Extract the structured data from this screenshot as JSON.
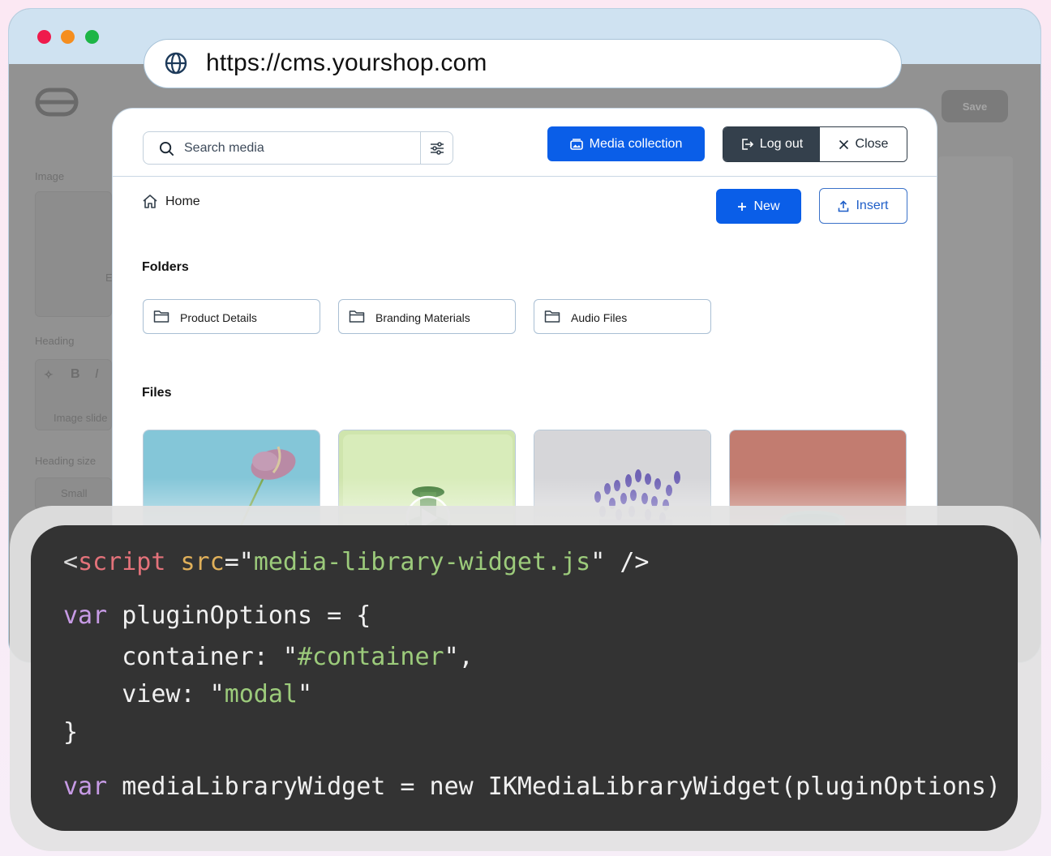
{
  "browser": {
    "url": "https://cms.yourshop.com"
  },
  "background_cms": {
    "save_label": "Save",
    "image_label": "Image",
    "heading_label": "Heading",
    "heading_placeholder": "Image slide",
    "heading_size_label": "Heading size",
    "heading_size_value": "Small",
    "toolbar_bold": "B",
    "toolbar_italic": "I",
    "image_partial_text": "E"
  },
  "modal": {
    "search_placeholder": "Search media",
    "media_collection_label": "Media collection",
    "logout_label": "Log out",
    "close_label": "Close",
    "breadcrumb_home": "Home",
    "new_label": "New",
    "insert_label": "Insert",
    "folders_title": "Folders",
    "folders": [
      {
        "label": "Product Details"
      },
      {
        "label": "Branding Materials"
      },
      {
        "label": "Audio Files"
      }
    ],
    "files_title": "Files",
    "files": [
      {
        "subject": "pink flower on blue background"
      },
      {
        "subject": "green vase video"
      },
      {
        "subject": "lavender plant on grey background"
      },
      {
        "subject": "teal mug on terracotta background"
      }
    ]
  },
  "code": {
    "line1": {
      "open": "<",
      "tag": "script",
      "sp": " ",
      "attr": "src",
      "eq": "=\"",
      "val": "media-library-widget.js",
      "close": "\" />"
    },
    "line2": {
      "kw": "var",
      "rest": " pluginOptions = {"
    },
    "line3": {
      "key": "    container: \"",
      "val": "#container",
      "end": "\","
    },
    "line4": {
      "key": "    view: \"",
      "val": "modal",
      "end": "\""
    },
    "line5": {
      "text": "}"
    },
    "line6": {
      "kw": "var",
      "rest": " mediaLibraryWidget = new IKMediaLibraryWidget(pluginOptions)"
    }
  },
  "colors": {
    "primary_blue": "#0a5ee8",
    "dark_button": "#34404c",
    "code_bg": "#333333",
    "code_keyword": "#c79be5",
    "code_string": "#9ccb7b"
  },
  "icons": [
    "globe-icon",
    "search-icon",
    "filter-icon",
    "media-collection-icon",
    "logout-icon",
    "close-icon",
    "home-icon",
    "plus-icon",
    "upload-icon",
    "folder-icon",
    "play-icon"
  ]
}
